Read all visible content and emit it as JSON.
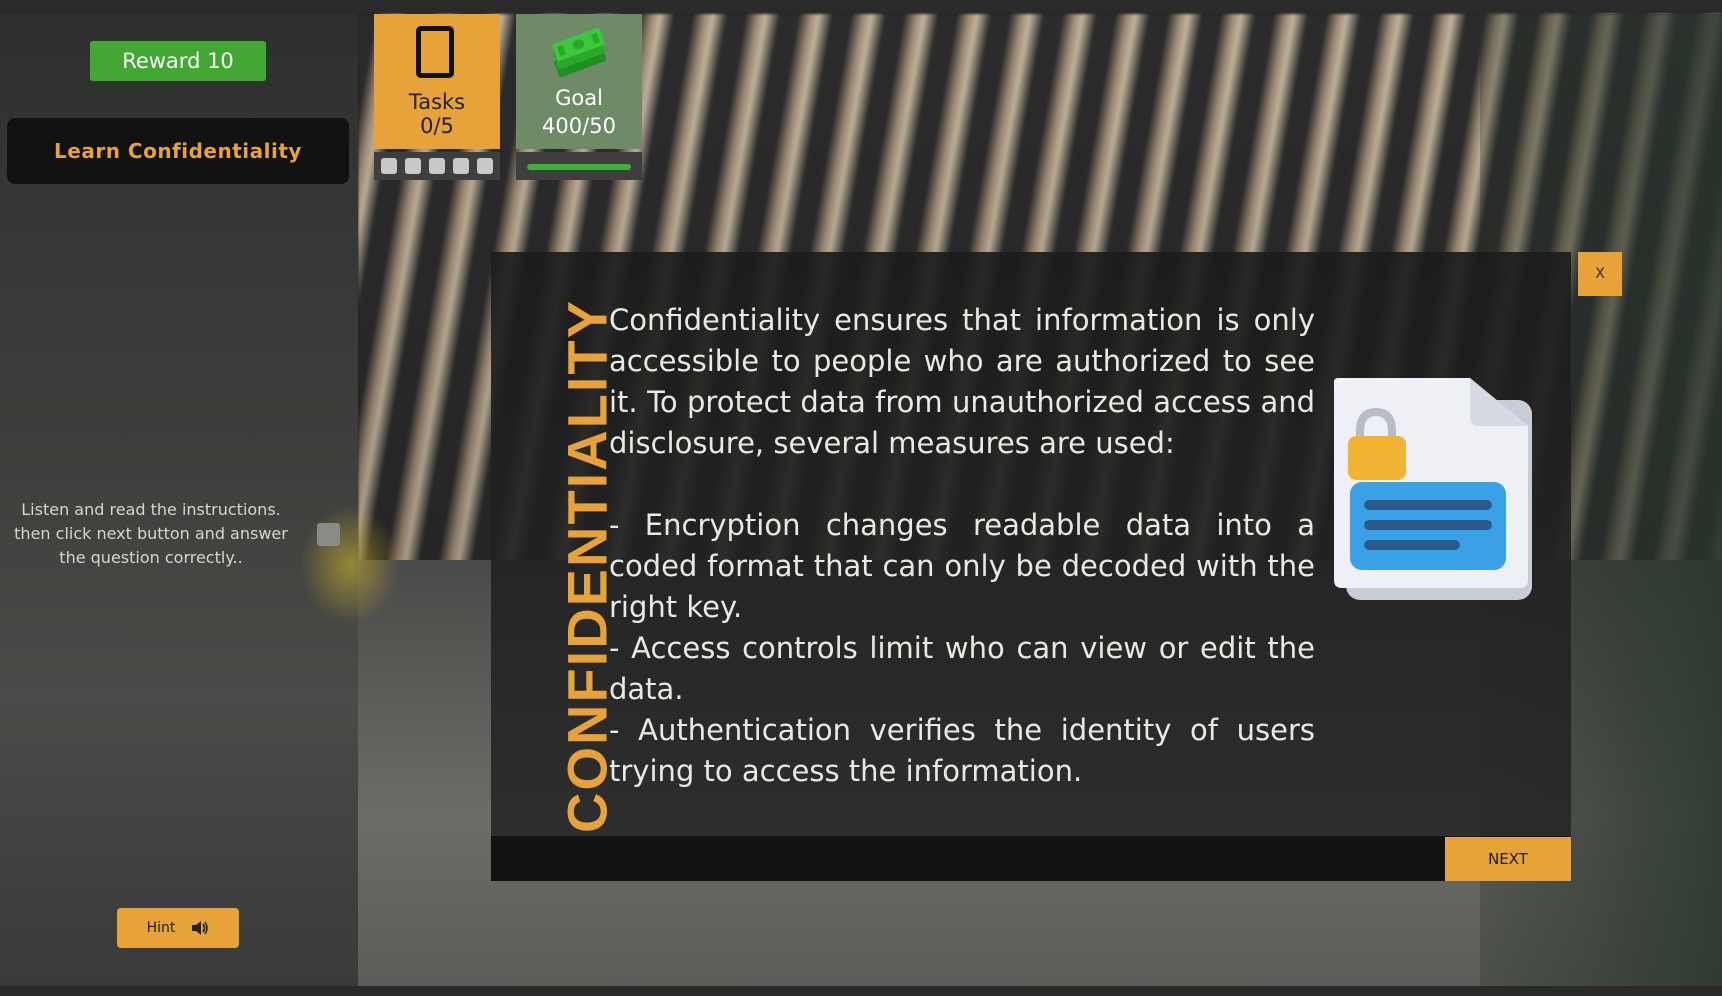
{
  "hud": {
    "reward_label": "Reward 10",
    "mission_title": "Learn Confidentiality",
    "tasks": {
      "label": "Tasks",
      "value": "0/5",
      "completed": 0,
      "total": 5
    },
    "goal": {
      "label": "Goal",
      "value": "400/50",
      "progress": 1.0
    }
  },
  "instructions": "Listen and read the instructions. then click next button and answer the question correctly..",
  "hint_label": "Hint",
  "dialog": {
    "title": "CONFIDENTIALITY",
    "body": "Confidentiality ensures that information is only accessible to people who are authorized to see it. To protect data from unauthorized access and disclosure, several measures are used:\n\n- Encryption changes readable data into a coded format that can only be decoded with the right key.\n- Access controls limit who can view or edit the data.\n- Authentication verifies the identity of users trying to access the information.",
    "close_label": "X",
    "next_label": "NEXT"
  },
  "colors": {
    "accent": "#e8a23a",
    "reward_green": "#43a733",
    "goal_card": "#6e8a66",
    "progress_green": "#41b036"
  },
  "icons": [
    "phone-icon",
    "money-icon",
    "speaker-icon",
    "locked-document-icon"
  ]
}
